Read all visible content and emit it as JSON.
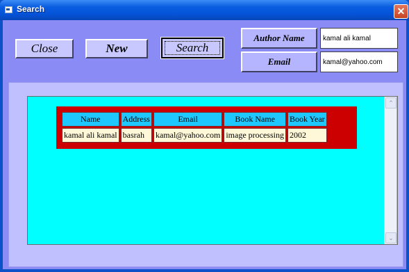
{
  "window": {
    "title": "Search",
    "close_glyph": "✕"
  },
  "buttons": {
    "close": "Close",
    "new": "New",
    "search": "Search"
  },
  "labels": {
    "author_name": "Author Name",
    "email": "Email"
  },
  "fields": {
    "author_name_value": "kamal ali kamal",
    "email_value": "kamal@yahoo.com"
  },
  "table": {
    "headers": [
      "Name",
      "Address",
      "Email",
      "Book Name",
      "Book Year"
    ],
    "rows": [
      [
        "kamal ali kamal",
        "basrah",
        "kamal@yahoo.com",
        "image processing",
        "2002"
      ]
    ]
  },
  "scroll": {
    "up": "⌃",
    "down": "⌄"
  },
  "colors": {
    "client": "#8b8bf5",
    "results_bg": "#00ffff",
    "table_frame": "#cc0000",
    "header_cell": "#1ec8ff"
  }
}
